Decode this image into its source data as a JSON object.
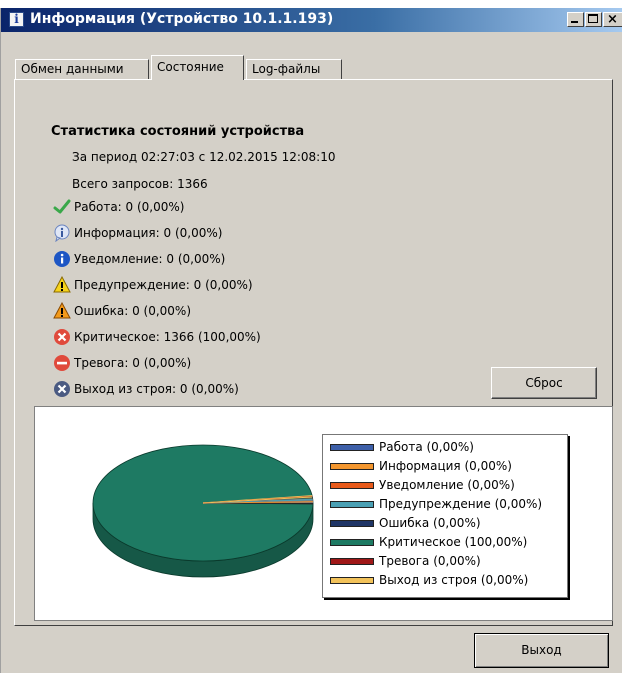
{
  "window": {
    "title": "Информация (Устройство 10.1.1.193)",
    "icon_glyph": "i"
  },
  "tabs": [
    {
      "label": "Обмен данными",
      "active": false
    },
    {
      "label": "Состояние",
      "active": true
    },
    {
      "label": "Log-файлы",
      "active": false
    }
  ],
  "stats": {
    "heading": "Статистика состояний устройства",
    "period": "За период 02:27:03 с 12.02.2015 12:08:10",
    "total": "Всего запросов: 1366",
    "items": [
      {
        "icon": "check-icon",
        "label": "Работа: 0 (0,00%)"
      },
      {
        "icon": "info-bubble-icon",
        "label": "Информация: 0 (0,00%)"
      },
      {
        "icon": "info-circle-icon",
        "label": "Уведомление: 0 (0,00%)"
      },
      {
        "icon": "warning-yellow-icon",
        "label": "Предупреждение: 0 (0,00%)"
      },
      {
        "icon": "warning-orange-icon",
        "label": "Ошибка: 0 (0,00%)"
      },
      {
        "icon": "critical-x-icon",
        "label": "Критическое: 1366 (100,00%)"
      },
      {
        "icon": "alarm-minus-icon",
        "label": "Тревога: 0 (0,00%)"
      },
      {
        "icon": "failure-x-icon",
        "label": "Выход из строя: 0 (0,00%)"
      }
    ]
  },
  "buttons": {
    "reset": "Сброс",
    "exit": "Выход"
  },
  "chart_data": {
    "type": "pie",
    "categories": [
      "Работа (0,00%)",
      "Информация (0,00%)",
      "Уведомление (0,00%)",
      "Предупреждение (0,00%)",
      "Ошибка (0,00%)",
      "Критическое (100,00%)",
      "Тревога (0,00%)",
      "Выход из строя (0,00%)"
    ],
    "values": [
      0,
      0,
      0,
      0,
      0,
      1366,
      0,
      0
    ],
    "colors": [
      "#3d5fa8",
      "#f3962e",
      "#e85a1a",
      "#4aa0b4",
      "#1f3566",
      "#1e7a63",
      "#a01818",
      "#f2c25a"
    ],
    "legend_position": "right"
  }
}
